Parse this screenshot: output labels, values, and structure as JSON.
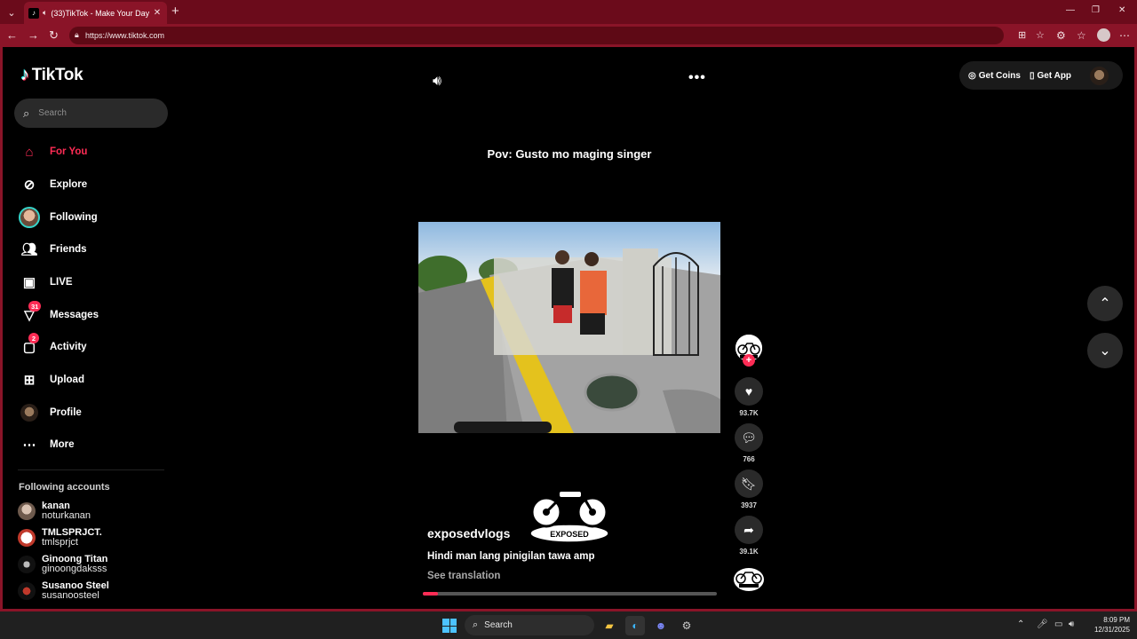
{
  "browser": {
    "tab_title": "(33)TikTok - Make Your Day",
    "url": "https://www.tiktok.com"
  },
  "sidebar": {
    "logo": "TikTok",
    "search_placeholder": "Search",
    "items": [
      {
        "label": "For You",
        "icon": "home-icon",
        "active": true
      },
      {
        "label": "Explore",
        "icon": "compass-icon"
      },
      {
        "label": "Following",
        "icon": "following-avatar"
      },
      {
        "label": "Friends",
        "icon": "friends-icon"
      },
      {
        "label": "LIVE",
        "icon": "live-icon"
      },
      {
        "label": "Messages",
        "icon": "messages-icon",
        "badge": "31"
      },
      {
        "label": "Activity",
        "icon": "activity-icon",
        "badge": "2"
      },
      {
        "label": "Upload",
        "icon": "upload-icon"
      },
      {
        "label": "Profile",
        "icon": "profile-avatar"
      },
      {
        "label": "More",
        "icon": "more-icon"
      }
    ],
    "following_title": "Following accounts",
    "following_accounts": [
      {
        "name": "kanan",
        "handle": "noturkanan"
      },
      {
        "name": "TMLSPRJCT.",
        "handle": "tmlsprjct"
      },
      {
        "name": "Ginoong Titan",
        "handle": "ginoongdaksss"
      },
      {
        "name": "Susanoo Steel",
        "handle": "susanoosteel"
      }
    ]
  },
  "header": {
    "get_coins": "Get Coins",
    "get_app": "Get App"
  },
  "video": {
    "caption": "Pov: Gusto mo maging singer",
    "author": "exposedvlogs",
    "description": "Hindi man lang pinigilan tawa amp",
    "see_translation": "See translation",
    "logo_text": "EXPOSED",
    "progress": 0.05,
    "likes": "93.7K",
    "comments": "766",
    "saves": "3937",
    "shares": "39.1K"
  },
  "taskbar": {
    "search": "Search",
    "time": "8:09 PM",
    "date": "12/31/2025"
  },
  "colors": {
    "accent": "#fe2c55",
    "browser_frame": "#8a1428"
  }
}
